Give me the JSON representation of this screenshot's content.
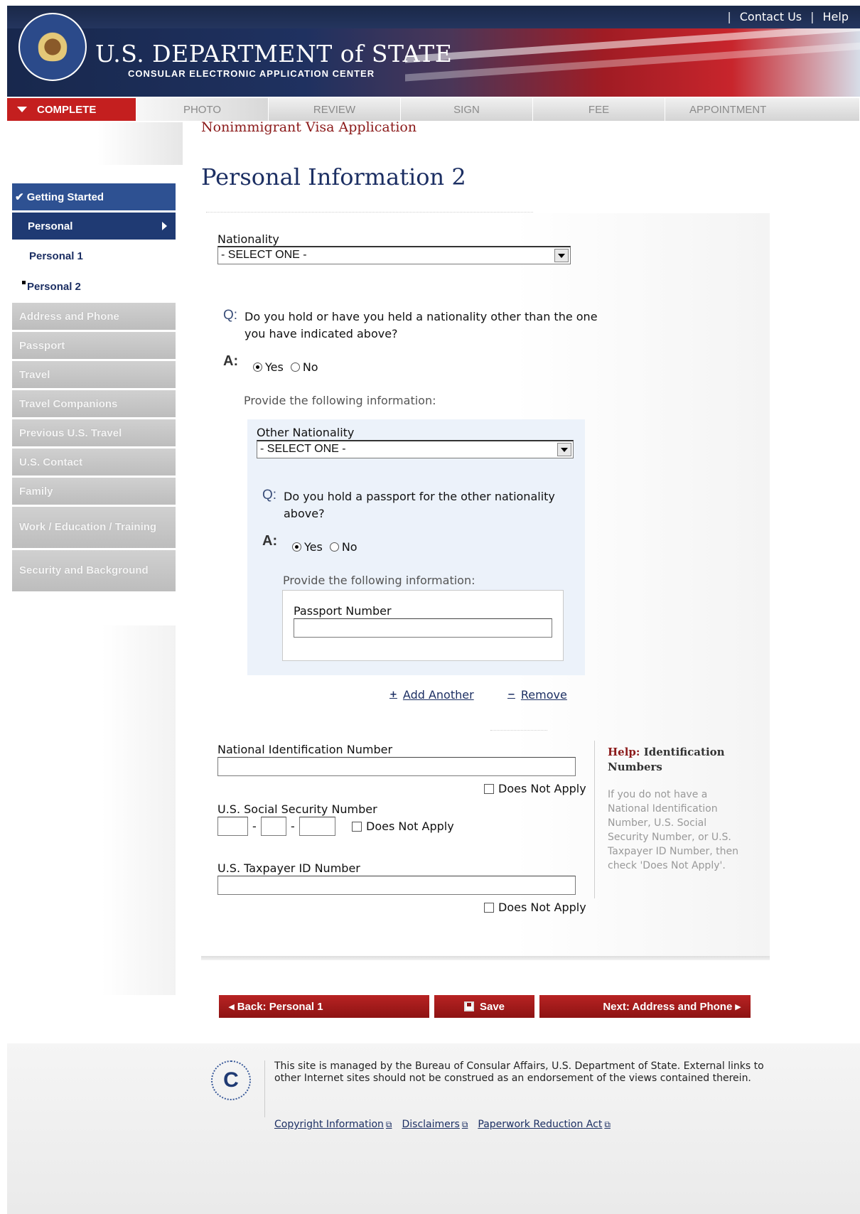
{
  "header": {
    "links": [
      "Contact Us",
      "Help"
    ],
    "dept_title": "U.S. DEPARTMENT of STATE",
    "dept_subtitle": "CONSULAR ELECTRONIC APPLICATION CENTER"
  },
  "tabs": [
    "COMPLETE",
    "PHOTO",
    "REVIEW",
    "SIGN",
    "FEE",
    "APPOINTMENT"
  ],
  "sidebar": {
    "items": [
      {
        "label": "✔ Getting Started"
      },
      {
        "label": "Personal"
      },
      {
        "label": "Personal 1"
      },
      {
        "label": "Personal 2"
      },
      {
        "label": "Address and Phone"
      },
      {
        "label": "Passport"
      },
      {
        "label": "Travel"
      },
      {
        "label": "Travel Companions"
      },
      {
        "label": "Previous U.S. Travel"
      },
      {
        "label": "U.S. Contact"
      },
      {
        "label": "Family"
      },
      {
        "label": "Work / Education / Training"
      },
      {
        "label": "Security and Background"
      }
    ]
  },
  "main": {
    "app_type": "Nonimmigrant Visa Application",
    "title": "Personal Information 2",
    "nationality_label": "Nationality",
    "nationality_value": "- SELECT ONE -",
    "q_label": "Q:",
    "a_label": "A:",
    "q1": "Do you hold or have you held a nationality other than the one you have indicated above?",
    "yes": "Yes",
    "no": "No",
    "provide": "Provide the following information:",
    "other_nat_label": "Other Nationality",
    "other_nat_value": "- SELECT ONE -",
    "q2": "Do you hold a passport for the other nationality above?",
    "passport_label": "Passport Number",
    "add_another": "Add Another",
    "remove": "Remove",
    "nin_label": "National Identification Number",
    "does_not_apply": "Does Not Apply",
    "ssn_label": "U.S. Social Security Number",
    "dash": "-",
    "taxpayer_label": "U.S. Taxpayer ID Number",
    "help_prefix": "Help:",
    "help_title": "Identification Numbers",
    "help_text": "If you do not have a National Identification Number, U.S. Social Security Number, or U.S. Taxpayer ID Number, then check 'Does Not Apply'."
  },
  "buttons": {
    "back": "◂ Back: Personal 1",
    "save": "Save",
    "next": "Next: Address and Phone ▸"
  },
  "footer": {
    "text": "This site is managed by the Bureau of Consular Affairs, U.S. Department of State. External links to other Internet sites should not be construed as an endorsement of the views contained therein.",
    "links": [
      "Copyright Information",
      "Disclaimers",
      "Paperwork Reduction Act"
    ],
    "seal_letter": "C"
  }
}
